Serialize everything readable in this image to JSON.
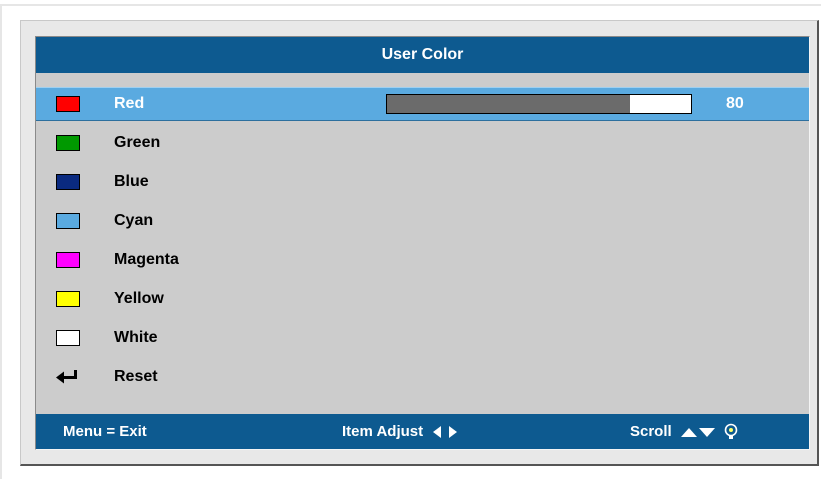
{
  "title": "User Color",
  "items": [
    {
      "label": "Red",
      "color": "#ff0000"
    },
    {
      "label": "Green",
      "color": "#009900"
    },
    {
      "label": "Blue",
      "color": "#0a2a80"
    },
    {
      "label": "Cyan",
      "color": "#5aaae0"
    },
    {
      "label": "Magenta",
      "color": "#ff00ff"
    },
    {
      "label": "Yellow",
      "color": "#ffff00"
    },
    {
      "label": "White",
      "color": "#ffffff"
    },
    {
      "label": "Reset",
      "icon": "enter-icon"
    }
  ],
  "selected_index": 0,
  "slider": {
    "value": "80",
    "fill_fraction": 0.8
  },
  "footer": {
    "menu_exit": "Menu = Exit",
    "item_adjust": "Item Adjust",
    "scroll": "Scroll",
    "icons": [
      "left-right-arrows-icon",
      "up-down-arrows-icon",
      "lightbulb-icon"
    ]
  },
  "colors": {
    "bar_blue": "#0d5a90",
    "highlight_blue": "#5aaae0",
    "panel_gray": "#cccccc"
  }
}
